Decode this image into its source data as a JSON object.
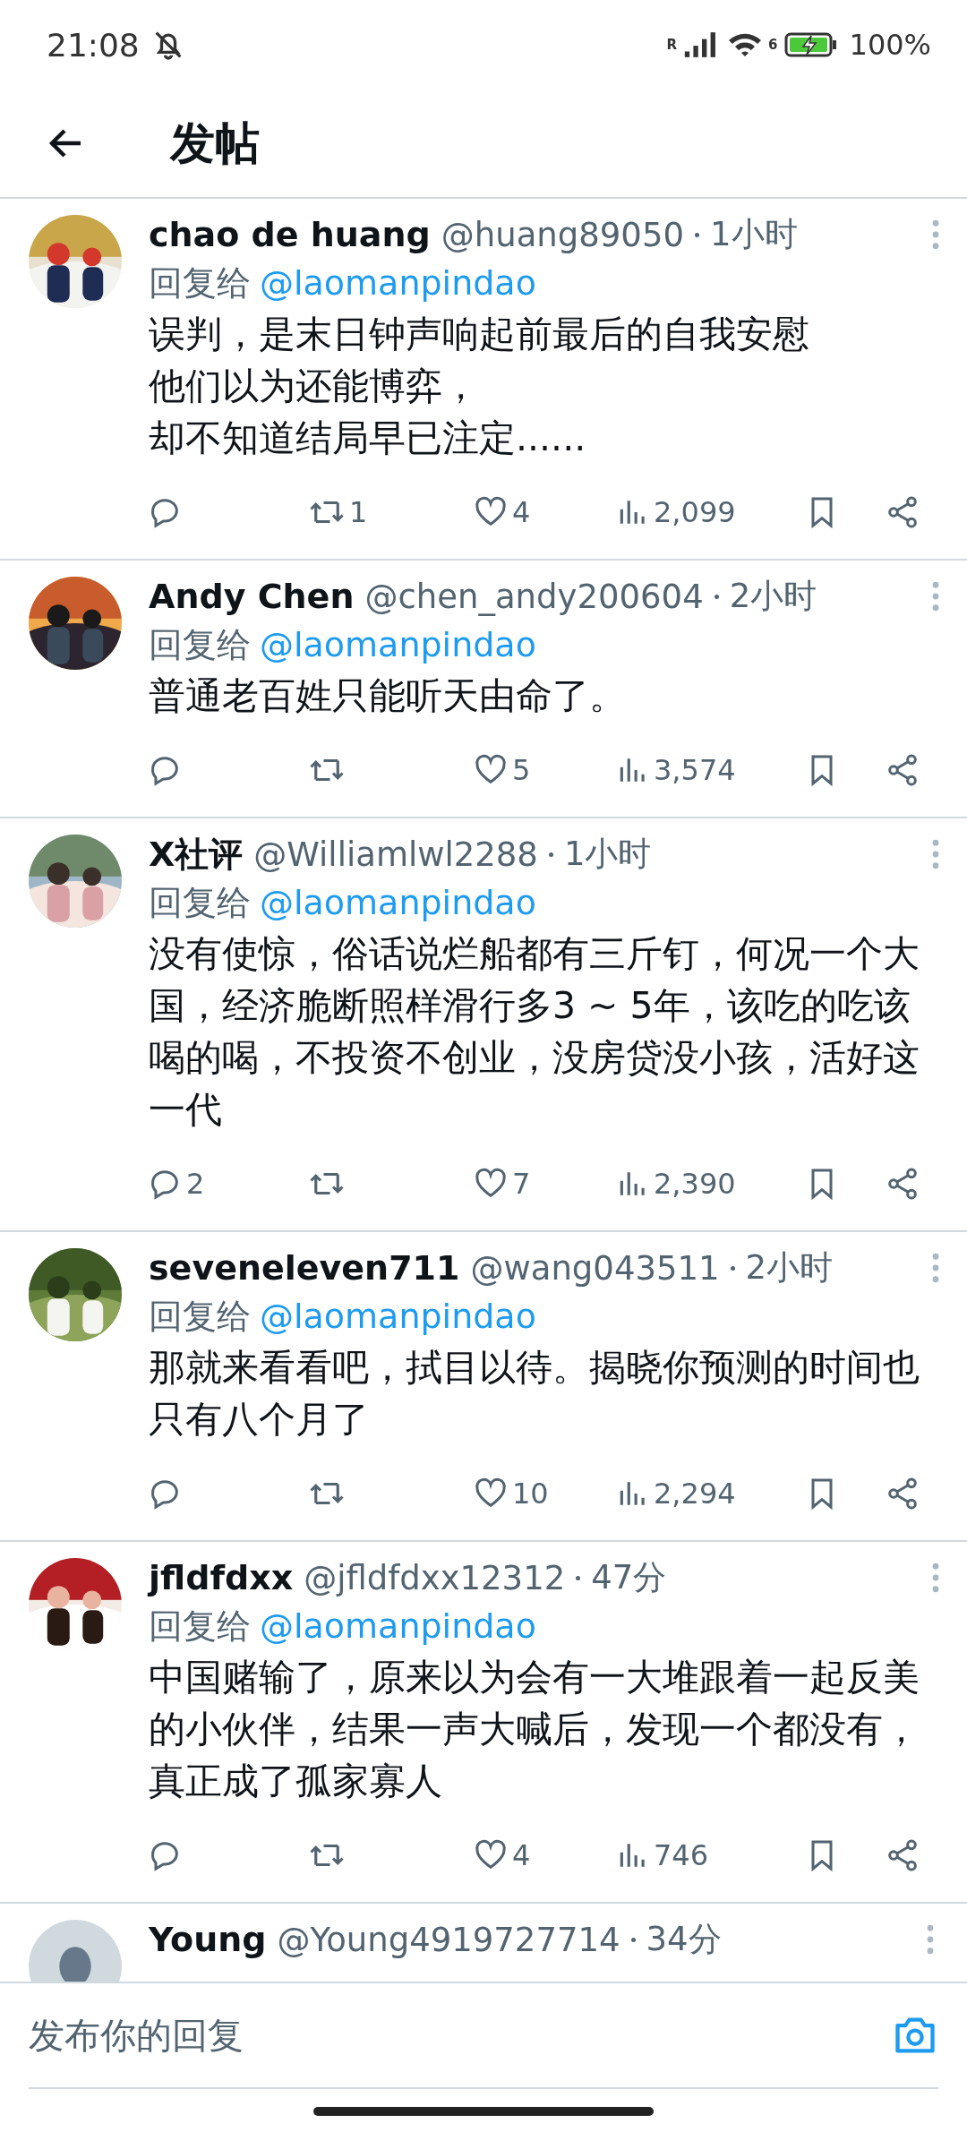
{
  "status_bar": {
    "time": "21:08",
    "signal_label": "R",
    "wifi_label": "6",
    "battery": "100%"
  },
  "header": {
    "title": "发帖"
  },
  "posts": [
    {
      "name": "chao de huang",
      "handle": "@huang89050",
      "time": "1小时",
      "reply_label": "回复给",
      "reply_to": "@laomanpindao",
      "body": [
        "误判，是末日钟声响起前最后的自我安慰",
        "他们以为还能博弈，",
        "却不知道结局早已注定......"
      ],
      "retweets": "1",
      "likes": "4",
      "views": "2,099"
    },
    {
      "name": "Andy Chen",
      "handle": "@chen_andy200604",
      "time": "2小时",
      "reply_label": "回复给",
      "reply_to": "@laomanpindao",
      "body": [
        "普通老百姓只能听天由命了。"
      ],
      "likes": "5",
      "views": "3,574"
    },
    {
      "name": "X社评",
      "handle": "@Williamlwl2288",
      "time": "1小时",
      "reply_label": "回复给",
      "reply_to": "@laomanpindao",
      "body": [
        "没有使惊，俗话说烂船都有三斤钉，何况一个大国，经济脆断照样滑行多3 ~ 5年，该吃的吃该喝的喝，不投资不创业，没房贷没小孩，活好这一代"
      ],
      "replies": "2",
      "likes": "7",
      "views": "2,390"
    },
    {
      "name": "seveneleven711",
      "handle": "@wang043511",
      "time": "2小时",
      "reply_label": "回复给",
      "reply_to": "@laomanpindao",
      "body": [
        "那就来看看吧，拭目以待。揭晓你预测的时间也只有八个月了"
      ],
      "likes": "10",
      "views": "2,294"
    },
    {
      "name": "jfldfdxx",
      "handle": "@jfldfdxx12312",
      "time": "47分",
      "reply_label": "回复给",
      "reply_to": "@laomanpindao",
      "body": [
        "中国赌输了，原来以为会有一大堆跟着一起反美的小伙伴，结果一声大喊后，发现一个都没有，真正成了孤家寡人"
      ],
      "likes": "4",
      "views": "746"
    },
    {
      "avatar": {
        "kind": "default"
      },
      "name": "Young",
      "handle": "@Young4919727714",
      "time": "34分"
    }
  ],
  "reply_bar": {
    "placeholder": "发布你的回复"
  }
}
